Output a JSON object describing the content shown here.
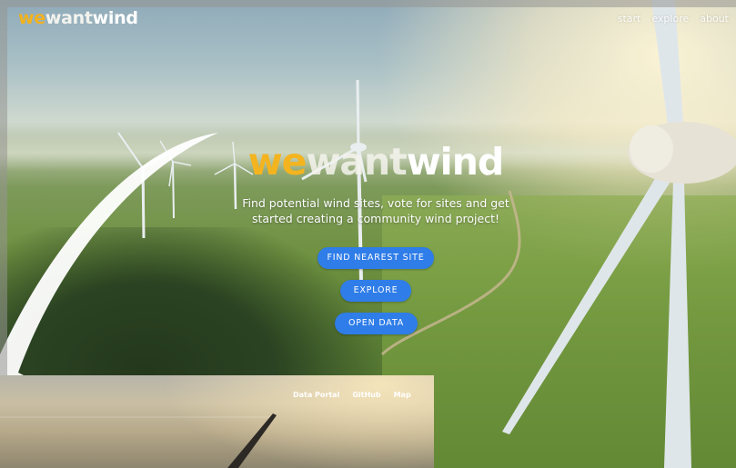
{
  "header": {
    "logo": {
      "part1": "we",
      "part2": "want",
      "part3": "wind"
    },
    "nav": [
      {
        "label": "start"
      },
      {
        "label": "explore"
      },
      {
        "label": "about"
      }
    ]
  },
  "hero": {
    "title": {
      "part1": "we",
      "part2": "want",
      "part3": "wind"
    },
    "tagline": "Find potential wind sites, vote for sites and get started creating a community wind project!",
    "buttons": {
      "find_nearest": "FIND NEAREST SITE",
      "explore": "EXPLORE",
      "open_data": "OPEN DATA"
    }
  },
  "inset": {
    "nav": [
      {
        "label": "Data Portal"
      },
      {
        "label": "GitHub"
      },
      {
        "label": "Map"
      }
    ]
  },
  "colors": {
    "brand_yellow": "#f2b21c",
    "button_blue": "#2f7de8"
  }
}
